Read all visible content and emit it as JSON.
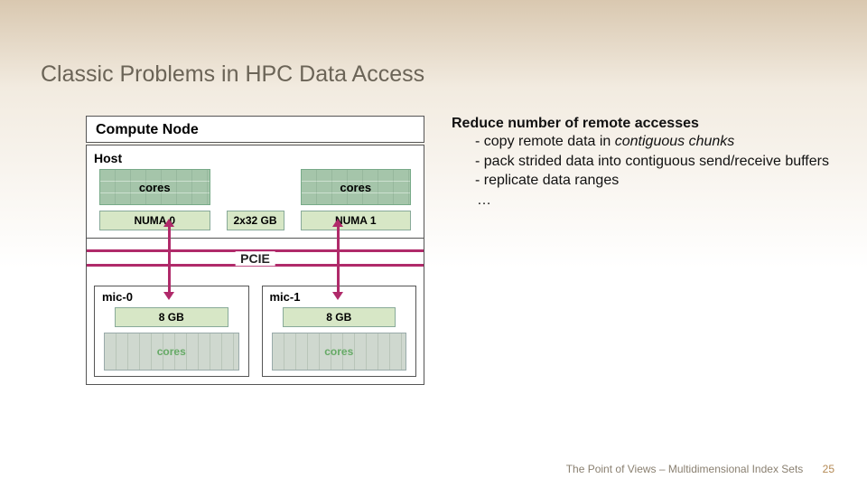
{
  "title": "Classic Problems in HPC Data Access",
  "diagram": {
    "compute_node": "Compute Node",
    "host": "Host",
    "cores": "cores",
    "numa0": "NUMA 0",
    "numa1": "NUMA 1",
    "host_mem": "2x32 GB",
    "pcie": "PCIE",
    "mic0": "mic-0",
    "mic1": "mic-1",
    "mic_mem": "8 GB",
    "mic_cores": "cores"
  },
  "text": {
    "heading": "Reduce number of remote accesses",
    "b1a": "copy remote data in ",
    "b1b": "contiguous chunks",
    "b2": "pack strided data into contiguous send/receive buffers",
    "b3": "replicate data ranges",
    "ell": "…"
  },
  "footer": {
    "text": "The Point of Views – Multidimensional Index Sets",
    "page": "25"
  }
}
